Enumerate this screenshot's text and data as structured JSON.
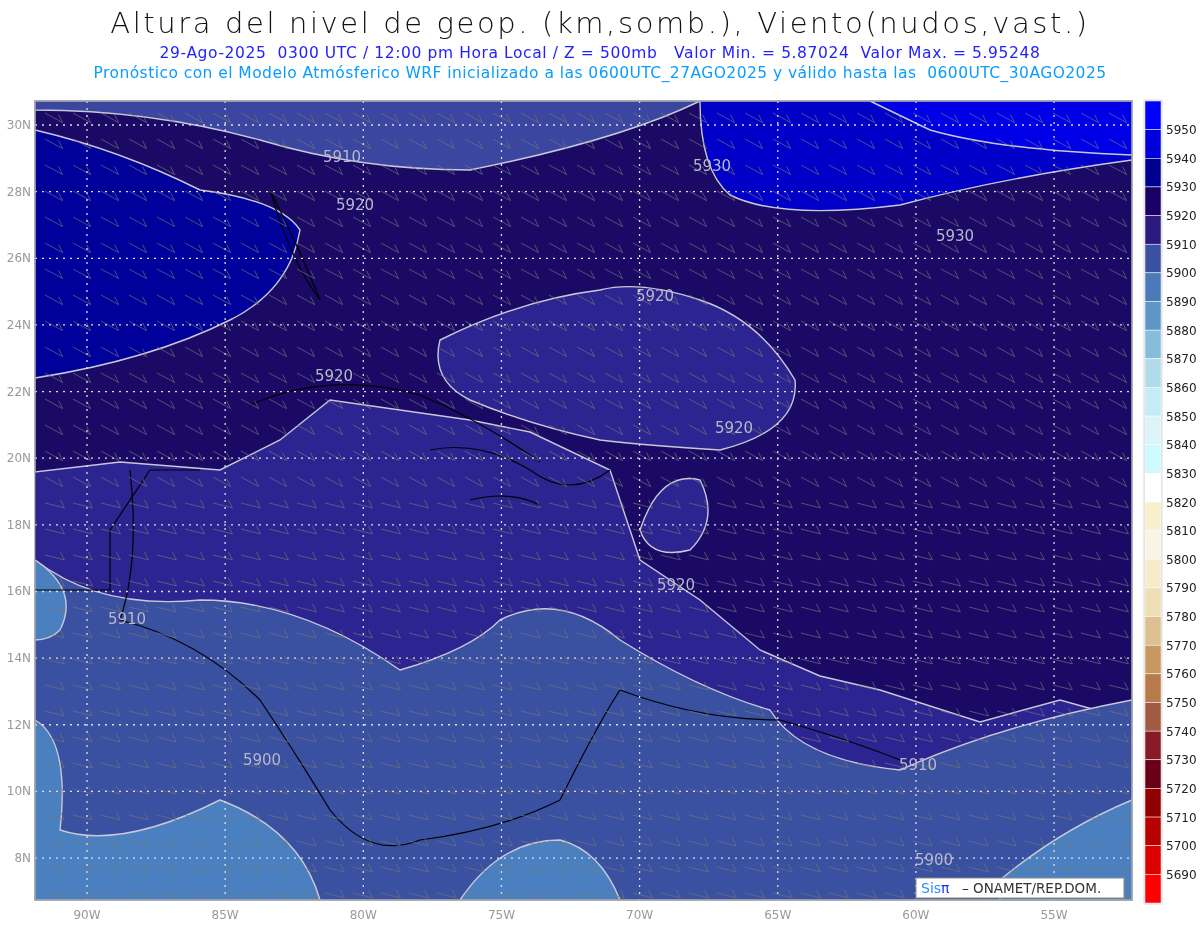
{
  "title": "Altura del nivel de geop. (km,somb.), Viento(nudos,vast.)",
  "subtitle": "29-Ago-2025  0300 UTC / 12:00 pm Hora Local / Z = 500mb   Valor Min. = 5.87024  Valor Max. = 5.95248",
  "forecast_note": "Pronóstico con el Modelo Atmósferico WRF inicializado a las 0600UTC_27AGO2025 y válido hasta las  0600UTC_30AGO2025",
  "map": {
    "lat_labels": [
      "30N",
      "28N",
      "26N",
      "24N",
      "22N",
      "20N",
      "18N",
      "16N",
      "14N",
      "12N",
      "10N",
      "8N"
    ],
    "lon_labels": [
      "90W",
      "85W",
      "80W",
      "75W",
      "70W",
      "65W",
      "60W",
      "55W"
    ],
    "contour_labels": [
      {
        "text": "5910"
      },
      {
        "text": "5930"
      },
      {
        "text": "5920"
      },
      {
        "text": "5930"
      },
      {
        "text": "5920"
      },
      {
        "text": "5920"
      },
      {
        "text": "5920"
      },
      {
        "text": "5920"
      },
      {
        "text": "5910"
      },
      {
        "text": "5900"
      },
      {
        "text": "5910"
      },
      {
        "text": "5900"
      }
    ]
  },
  "colorbar": [
    {
      "color": "#0000ff",
      "label": "5950"
    },
    {
      "color": "#0000dd",
      "label": "5940"
    },
    {
      "color": "#000090",
      "label": "5930"
    },
    {
      "color": "#1a0066",
      "label": "5920"
    },
    {
      "color": "#2a1a80",
      "label": "5910"
    },
    {
      "color": "#3a50a0",
      "label": "5900"
    },
    {
      "color": "#4a7ab8",
      "label": "5890"
    },
    {
      "color": "#5e96c8",
      "label": "5880"
    },
    {
      "color": "#86bcdc",
      "label": "5870"
    },
    {
      "color": "#b0dcea",
      "label": "5860"
    },
    {
      "color": "#c4ecf4",
      "label": "5850"
    },
    {
      "color": "#dcf4f8",
      "label": "5840"
    },
    {
      "color": "#ccfafe",
      "label": "5830"
    },
    {
      "color": "#ffffff",
      "label": "5820"
    },
    {
      "color": "#f8f0cc",
      "label": "5810"
    },
    {
      "color": "#faf4e4",
      "label": "5800"
    },
    {
      "color": "#f6eccc",
      "label": "5790"
    },
    {
      "color": "#eedfb4",
      "label": "5780"
    },
    {
      "color": "#dcc090",
      "label": "5770"
    },
    {
      "color": "#c89860",
      "label": "5760"
    },
    {
      "color": "#b87a48",
      "label": "5750"
    },
    {
      "color": "#a05a40",
      "label": "5740"
    },
    {
      "color": "#881a28",
      "label": "5730"
    },
    {
      "color": "#6a0018",
      "label": "5720"
    },
    {
      "color": "#900000",
      "label": "5710"
    },
    {
      "color": "#b80000",
      "label": "5700"
    },
    {
      "color": "#dc0000",
      "label": "5690"
    },
    {
      "color": "#ff0000"
    }
  ],
  "credit": {
    "brand": "Sis",
    "brand_symbol": "π",
    "text": "– ONAMET/REP.DOM."
  }
}
